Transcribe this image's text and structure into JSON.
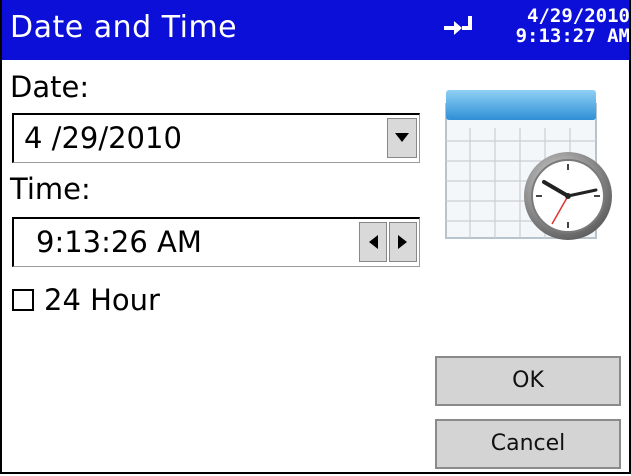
{
  "titlebar": {
    "title": "Date and Time",
    "date": "4/29/2010",
    "time": "9:13:27 AM",
    "connection_icon": "connection-arrow-icon"
  },
  "form": {
    "date_label": "Date:",
    "date_value": "4 /29/2010",
    "time_label": "Time:",
    "time_value": "9:13:26 AM",
    "hour24_label": "24 Hour",
    "hour24_checked": false
  },
  "buttons": {
    "ok": "OK",
    "cancel": "Cancel"
  },
  "icons": {
    "dropdown": "chevron-down-icon",
    "spin_left": "arrow-left-icon",
    "spin_right": "arrow-right-icon",
    "illustration": "calendar-clock-icon"
  },
  "colors": {
    "titlebar_bg": "#0b0fd8",
    "button_bg": "#d4d4d4"
  }
}
